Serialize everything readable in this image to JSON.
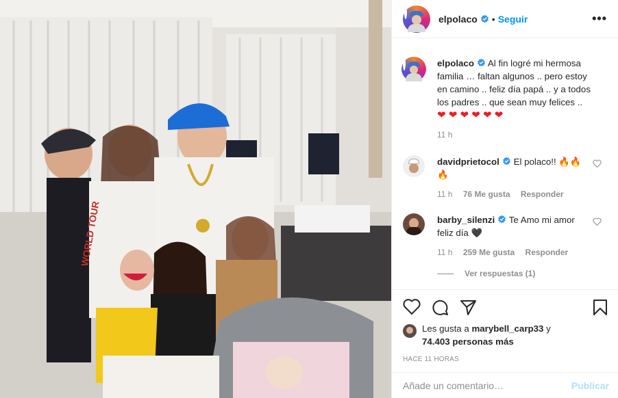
{
  "post": {
    "username": "elpolaco",
    "follow_label": "Seguir",
    "separator": "•",
    "more_label": "•••",
    "photo_alt_icon": "family-photo"
  },
  "caption": {
    "username": "elpolaco",
    "text": "Al fin logré mi hermosa familia … faltan algunos .. pero estoy en camino .. feliz día papá .. y a todos los padres .. que sean muy felices ..",
    "hearts": "❤ ❤ ❤ ❤ ❤ ❤",
    "time": "11 h"
  },
  "comments": [
    {
      "username": "davidprietocol",
      "text": "El polaco!! 🔥🔥🔥",
      "time": "11 h",
      "likes": "76 Me gusta",
      "reply": "Responder"
    },
    {
      "username": "barby_silenzi",
      "text": "Te Amo mi amor feliz día 🖤",
      "time": "11 h",
      "likes": "259 Me gusta",
      "reply": "Responder"
    }
  ],
  "view_replies": "Ver respuestas (1)",
  "likes": {
    "prefix": "Les gusta a ",
    "user": "marybell_carp33",
    "conj": " y",
    "count": "74.403 personas más"
  },
  "posted_ago": "HACE 11 HORAS",
  "composer": {
    "placeholder": "Añade un comentario…",
    "post_label": "Publicar"
  },
  "colors": {
    "accent": "#0095f6",
    "verified": "#3897f0",
    "heart": "#ed1c24",
    "muted": "#8e8e8e"
  },
  "icons": [
    "verified-badge-icon",
    "more-options-icon",
    "heart-icon",
    "comment-icon",
    "share-icon",
    "bookmark-icon"
  ]
}
